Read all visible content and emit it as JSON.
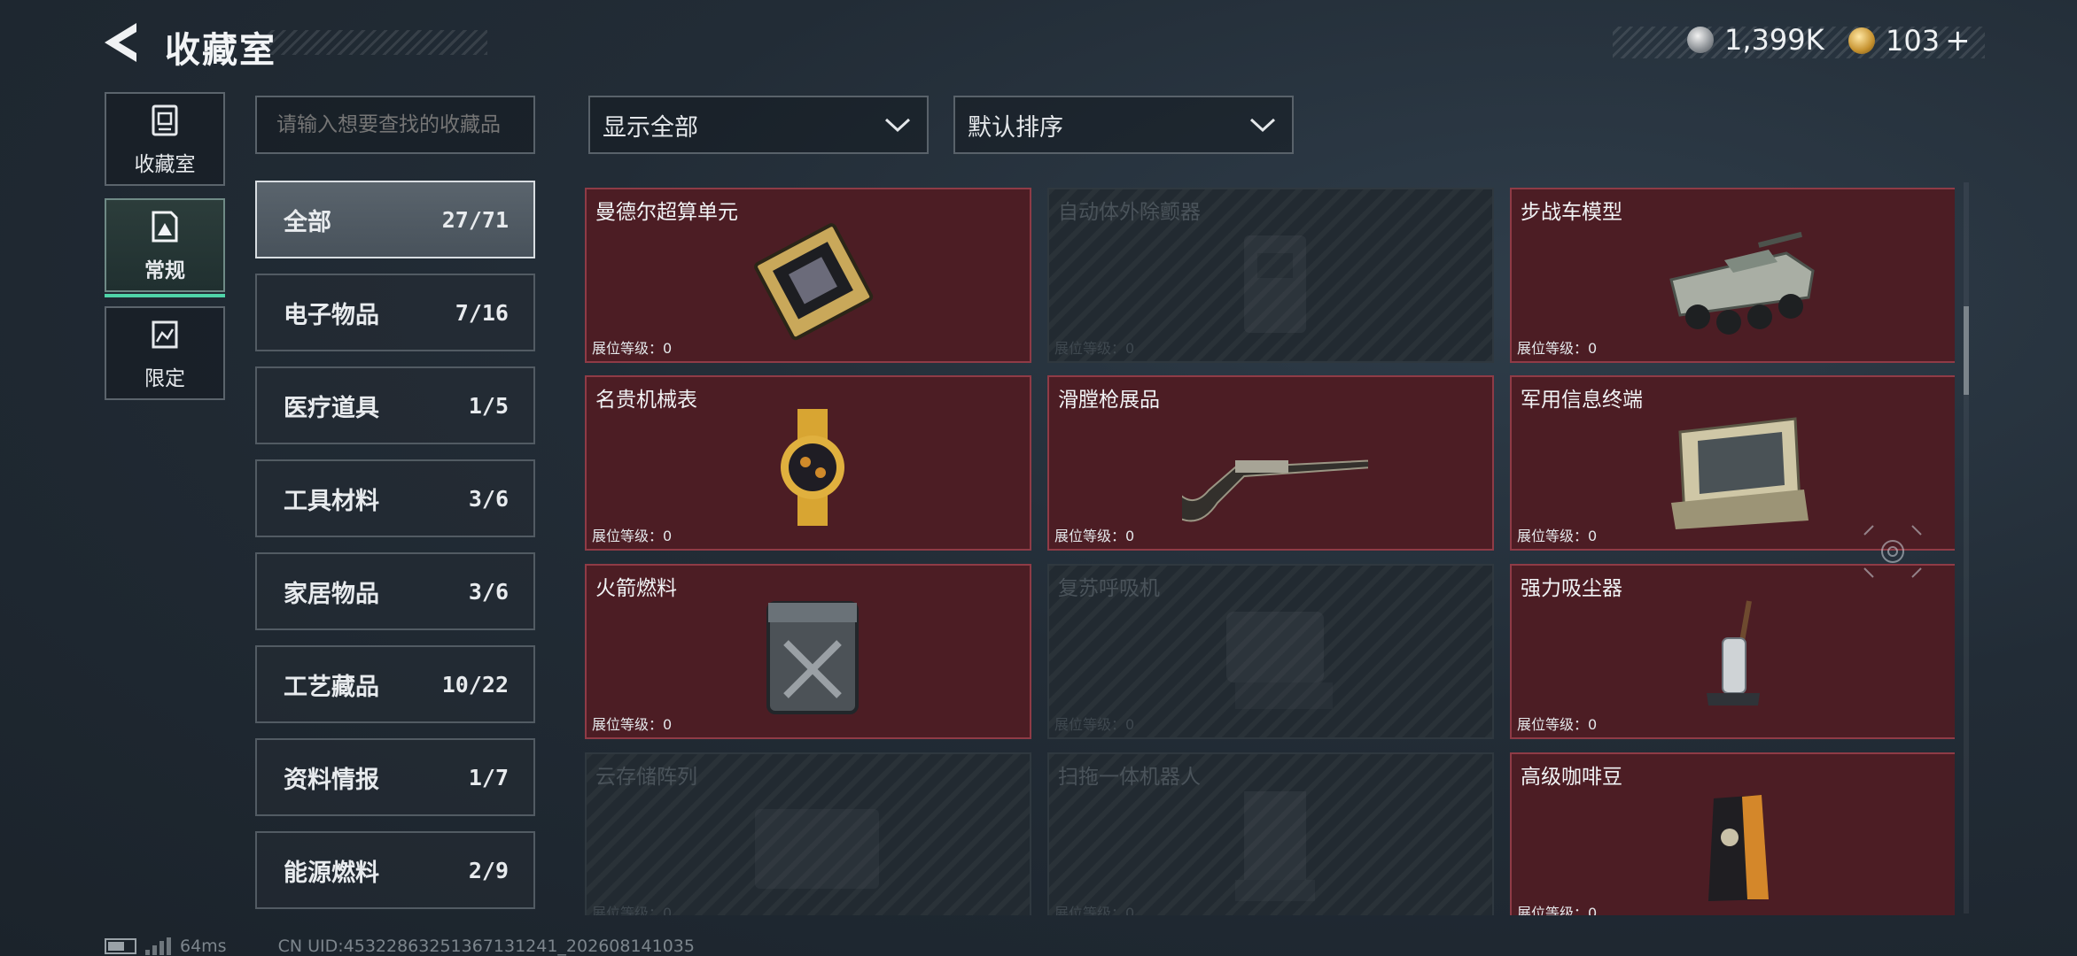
{
  "header": {
    "title": "收藏室",
    "currencies": [
      {
        "icon": "silver-coin-icon",
        "value": "1,399K"
      },
      {
        "icon": "gold-coin-icon",
        "value": "103",
        "suffix": "+"
      }
    ]
  },
  "nav": [
    {
      "label": "收藏室",
      "icon": "collection-room-icon"
    },
    {
      "label": "常规",
      "icon": "regular-icon",
      "selected": true
    },
    {
      "label": "限定",
      "icon": "limited-icon"
    }
  ],
  "search": {
    "placeholder": "请输入想要查找的收藏品"
  },
  "categories": [
    {
      "label": "全部",
      "count": "27/71",
      "active": true
    },
    {
      "label": "电子物品",
      "count": "7/16"
    },
    {
      "label": "医疗道具",
      "count": "1/5"
    },
    {
      "label": "工具材料",
      "count": "3/6"
    },
    {
      "label": "家居物品",
      "count": "3/6"
    },
    {
      "label": "工艺藏品",
      "count": "10/22"
    },
    {
      "label": "资料情报",
      "count": "1/7"
    },
    {
      "label": "能源燃料",
      "count": "2/9"
    }
  ],
  "filters": {
    "display": "显示全部",
    "sort": "默认排序"
  },
  "level_label": "展位等级：0",
  "items": [
    {
      "name": "曼德尔超算单元",
      "owned": true,
      "icon": "computing-unit-icon"
    },
    {
      "name": "自动体外除颤器",
      "owned": false,
      "icon": "defibrillator-icon"
    },
    {
      "name": "步战车模型",
      "owned": true,
      "icon": "ifv-model-icon"
    },
    {
      "name": "名贵机械表",
      "owned": true,
      "icon": "luxury-watch-icon"
    },
    {
      "name": "滑膛枪展品",
      "owned": true,
      "icon": "musket-icon"
    },
    {
      "name": "军用信息终端",
      "owned": true,
      "icon": "military-terminal-icon"
    },
    {
      "name": "火箭燃料",
      "owned": true,
      "icon": "fuel-can-icon"
    },
    {
      "name": "复苏呼吸机",
      "owned": false,
      "icon": "ventilator-icon"
    },
    {
      "name": "强力吸尘器",
      "owned": true,
      "icon": "vacuum-cleaner-icon"
    },
    {
      "name": "云存储阵列",
      "owned": false,
      "icon": "storage-array-icon"
    },
    {
      "name": "扫拖一体机器人",
      "owned": false,
      "icon": "robot-mop-icon"
    },
    {
      "name": "高级咖啡豆",
      "owned": true,
      "icon": "coffee-beans-icon"
    }
  ],
  "status": {
    "latency": "64ms",
    "uid": "CN UID:4532286325136713124​1_202608141035"
  },
  "colors": {
    "owned_card": "#4c1d24",
    "locked_card": "#222a31",
    "accent": "#4fd4a8"
  }
}
